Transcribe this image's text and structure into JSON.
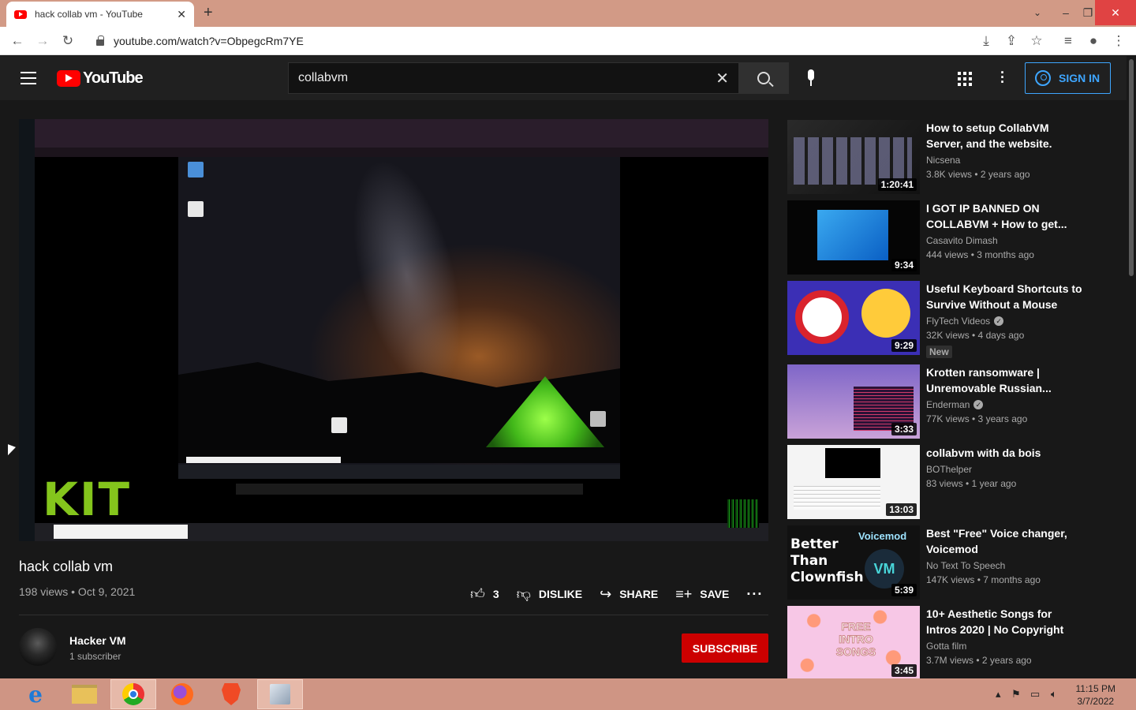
{
  "browser": {
    "tab_title": "hack collab vm - YouTube",
    "url": "youtube.com/watch?v=ObpegcRm7YE"
  },
  "youtube": {
    "logo": "YouTube",
    "search_value": "collabvm",
    "signin": "SIGN IN"
  },
  "video": {
    "overlay_text": "KIT",
    "title": "hack collab vm",
    "meta": "198 views • Oct 9, 2021",
    "like_count": "3",
    "dislike": "DISLIKE",
    "share": "SHARE",
    "save": "SAVE",
    "channel": "Hacker VM",
    "subscribers": "1 subscriber",
    "subscribe": "SUBSCRIBE"
  },
  "recommendations": [
    {
      "title": "How to setup CollabVM Server, and the website.",
      "channel": "Nicsena",
      "verified": false,
      "stats": "3.8K views • 2 years ago",
      "duration": "1:20:41",
      "badge": ""
    },
    {
      "title": "I GOT IP BANNED ON COLLABVM + How to get...",
      "channel": "Casavito Dimash",
      "verified": false,
      "stats": "444 views • 3 months ago",
      "duration": "9:34",
      "badge": ""
    },
    {
      "title": "Useful Keyboard Shortcuts to Survive Without a Mouse",
      "channel": "FlyTech Videos",
      "verified": true,
      "stats": "32K views • 4 days ago",
      "duration": "9:29",
      "badge": "New"
    },
    {
      "title": "Krotten ransomware | Unremovable Russian...",
      "channel": "Enderman",
      "verified": true,
      "stats": "77K views • 3 years ago",
      "duration": "3:33",
      "badge": ""
    },
    {
      "title": "collabvm with da bois",
      "channel": "BOThelper",
      "verified": false,
      "stats": "83 views • 1 year ago",
      "duration": "13:03",
      "badge": ""
    },
    {
      "title": "Best \"Free\" Voice changer, Voicemod",
      "channel": "No Text To Speech",
      "verified": false,
      "stats": "147K views • 7 months ago",
      "duration": "5:39",
      "badge": ""
    },
    {
      "title": "10+ Aesthetic Songs for Intros 2020 | No Copyright",
      "channel": "Gotta film",
      "verified": false,
      "stats": "3.7M views • 2 years ago",
      "duration": "3:45",
      "badge": ""
    }
  ],
  "thumb_text": {
    "voicemod_left": "Better Than Clownfish",
    "voicemod_right": "Voicemod",
    "intro": "FREE INTRO SONGS"
  },
  "taskbar": {
    "time": "11:15 PM",
    "date": "3/7/2022"
  }
}
